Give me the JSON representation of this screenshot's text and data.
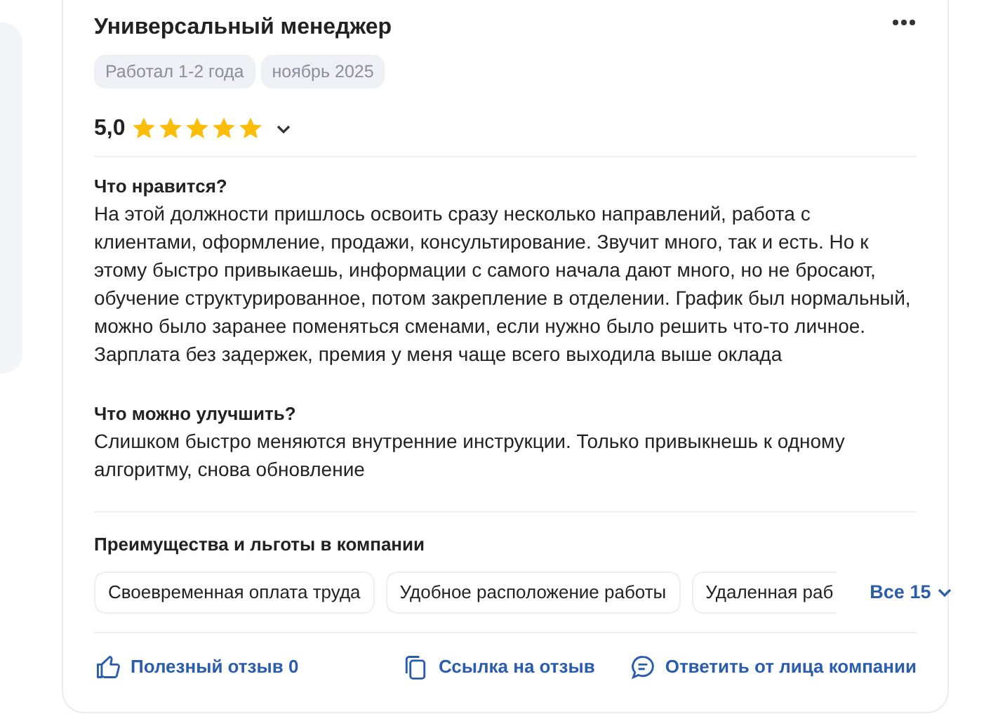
{
  "review": {
    "title": "Универсальный менеджер",
    "tags": [
      "Работал 1-2 года",
      "ноябрь 2025"
    ],
    "rating": "5,0",
    "stars": 5,
    "sections": [
      {
        "heading": "Что нравится?",
        "text": "На этой должности пришлось освоить сразу несколько направлений, работа с клиентами, оформление, продажи, консультирование. Звучит много, так и есть. Но к этому быстро привыкаешь, информации с самого начала дают много, но не бросают, обучение структурированное, потом закрепление в отделении. График был нормальный, можно было заранее поменяться сменами, если нужно было решить что-то личное. Зарплата без задержек, премия у меня чаще всего выходила выше оклада"
      },
      {
        "heading": "Что можно улучшить?",
        "text": "Слишком быстро меняются внутренние инструкции. Только привыкнешь к одному алгоритму, снова обновление"
      }
    ],
    "benefits": {
      "heading": "Преимущества и льготы в компании",
      "items": [
        "Своевременная оплата труда",
        "Удобное расположение работы",
        "Удаленная раб"
      ],
      "more": "Все 15"
    },
    "actions": [
      {
        "kind": "like",
        "label": "Полезный отзыв 0"
      },
      {
        "kind": "link",
        "label": "Ссылка на отзыв"
      },
      {
        "kind": "reply",
        "label": "Ответить от лица компании"
      }
    ]
  }
}
